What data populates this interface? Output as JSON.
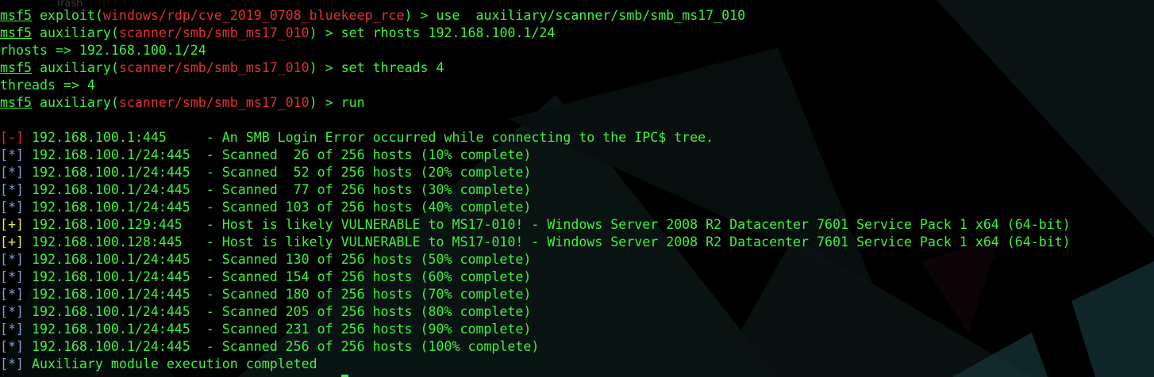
{
  "desktop": {
    "label": "Trash"
  },
  "prompt": {
    "app": "msf5"
  },
  "lines": [
    {
      "module_type": "exploit",
      "module": "windows/rdp/cve_2019_0708_bluekeep_rce",
      "command": "use  auxiliary/scanner/smb/smb_ms17_010"
    },
    {
      "module_type": "auxiliary",
      "module": "scanner/smb/smb_ms17_010",
      "command": "set rhosts 192.168.100.1/24"
    },
    {
      "text": "rhosts => 192.168.100.1/24"
    },
    {
      "module_type": "auxiliary",
      "module": "scanner/smb/smb_ms17_010",
      "command": "set threads 4"
    },
    {
      "text": "threads => 4"
    },
    {
      "module_type": "auxiliary",
      "module": "scanner/smb/smb_ms17_010",
      "command": "run"
    }
  ],
  "output": [
    {
      "status": "[-]",
      "text": "192.168.100.1:445     - An SMB Login Error occurred while connecting to the IPC$ tree."
    },
    {
      "status": "[*]",
      "text": "192.168.100.1/24:445  - Scanned  26 of 256 hosts (10% complete)"
    },
    {
      "status": "[*]",
      "text": "192.168.100.1/24:445  - Scanned  52 of 256 hosts (20% complete)"
    },
    {
      "status": "[*]",
      "text": "192.168.100.1/24:445  - Scanned  77 of 256 hosts (30% complete)"
    },
    {
      "status": "[*]",
      "text": "192.168.100.1/24:445  - Scanned 103 of 256 hosts (40% complete)"
    },
    {
      "status": "[+]",
      "text": "192.168.100.129:445   - Host is likely VULNERABLE to MS17-010! - Windows Server 2008 R2 Datacenter 7601 Service Pack 1 x64 (64-bit)"
    },
    {
      "status": "[+]",
      "text": "192.168.100.128:445   - Host is likely VULNERABLE to MS17-010! - Windows Server 2008 R2 Datacenter 7601 Service Pack 1 x64 (64-bit)"
    },
    {
      "status": "[*]",
      "text": "192.168.100.1/24:445  - Scanned 130 of 256 hosts (50% complete)"
    },
    {
      "status": "[*]",
      "text": "192.168.100.1/24:445  - Scanned 154 of 256 hosts (60% complete)"
    },
    {
      "status": "[*]",
      "text": "192.168.100.1/24:445  - Scanned 180 of 256 hosts (70% complete)"
    },
    {
      "status": "[*]",
      "text": "192.168.100.1/24:445  - Scanned 205 of 256 hosts (80% complete)"
    },
    {
      "status": "[*]",
      "text": "192.168.100.1/24:445  - Scanned 231 of 256 hosts (90% complete)"
    },
    {
      "status": "[*]",
      "text": "192.168.100.1/24:445  - Scanned 256 of 256 hosts (100% complete)"
    },
    {
      "status": "[*]",
      "text": "Auxiliary module execution completed"
    }
  ],
  "colors": {
    "text_green": "#3ef23e",
    "module_red": "#e0312f",
    "status_info_blue": "#7f9fd9",
    "status_good_yellow": "#e8e84a",
    "status_error_red": "#e0312f",
    "background": "#000000"
  }
}
